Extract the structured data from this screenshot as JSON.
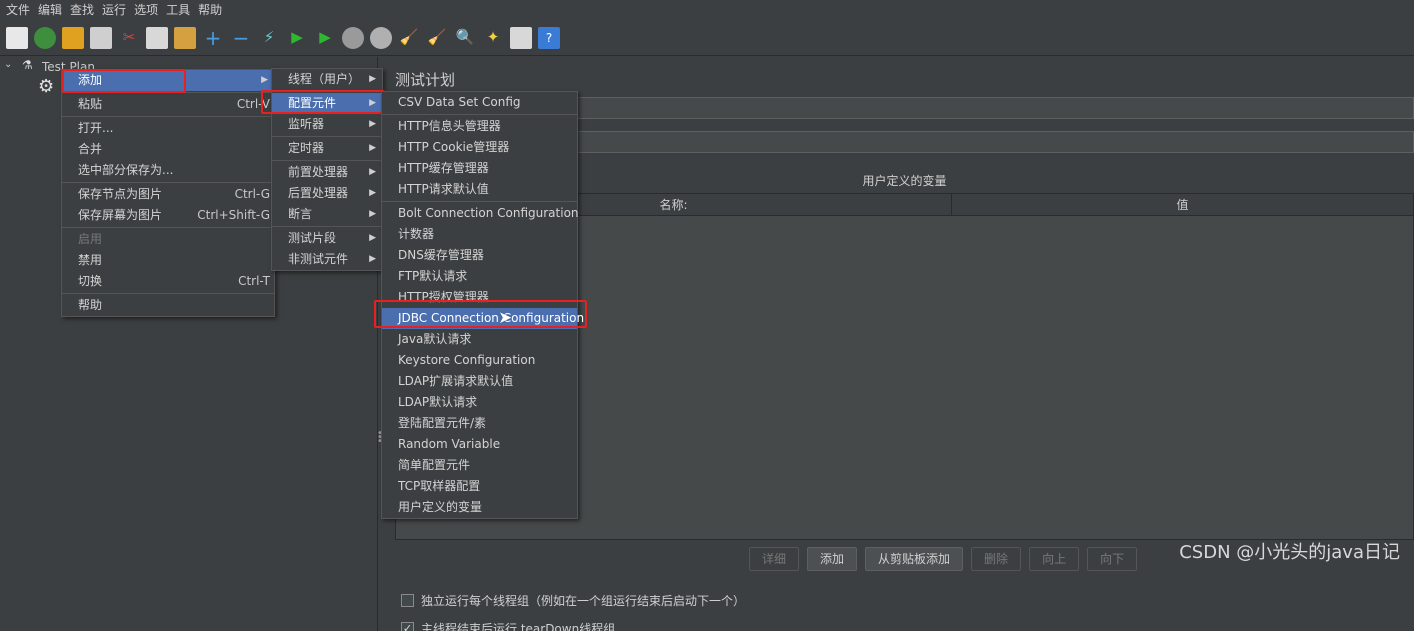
{
  "menubar": [
    "文件",
    "编辑",
    "查找",
    "运行",
    "选项",
    "工具",
    "帮助"
  ],
  "tree": {
    "root_label": "Test Plan"
  },
  "right_panel": {
    "title": "测试计划",
    "vars_title": "用户定义的变量",
    "col_name": "名称:",
    "col_value": "值",
    "buttons": [
      {
        "label": "详细",
        "enabled": false
      },
      {
        "label": "添加",
        "enabled": true
      },
      {
        "label": "从剪贴板添加",
        "enabled": true
      },
      {
        "label": "删除",
        "enabled": false
      },
      {
        "label": "向上",
        "enabled": false
      },
      {
        "label": "向下",
        "enabled": false
      }
    ],
    "checkbox1": "独立运行每个线程组（例如在一个组运行结束后启动下一个）",
    "checkbox2": "主线程结束后运行 tearDown线程组"
  },
  "context_menu": {
    "add": "添加",
    "paste": "粘贴",
    "paste_sc": "Ctrl-V",
    "open": "打开...",
    "merge": "合并",
    "save_selection": "选中部分保存为...",
    "save_node_img": "保存节点为图片",
    "save_node_img_sc": "Ctrl-G",
    "save_screen_img": "保存屏幕为图片",
    "save_screen_img_sc": "Ctrl+Shift-G",
    "enable": "启用",
    "disable": "禁用",
    "toggle": "切换",
    "toggle_sc": "Ctrl-T",
    "help": "帮助"
  },
  "submenu_add": [
    "线程（用户）",
    "配置元件",
    "监听器",
    "定时器",
    "前置处理器",
    "后置处理器",
    "断言",
    "测试片段",
    "非测试元件"
  ],
  "submenu_config": [
    "CSV Data Set Config",
    "HTTP信息头管理器",
    "HTTP Cookie管理器",
    "HTTP缓存管理器",
    "HTTP请求默认值",
    "Bolt Connection Configuration",
    "计数器",
    "DNS缓存管理器",
    "FTP默认请求",
    "HTTP授权管理器",
    "JDBC Connection Configuration",
    "Java默认请求",
    "Keystore Configuration",
    "LDAP扩展请求默认值",
    "LDAP默认请求",
    "登陆配置元件/素",
    "Random Variable",
    "简单配置元件",
    "TCP取样器配置",
    "用户定义的变量"
  ],
  "watermark": "CSDN @小光头的java日记"
}
